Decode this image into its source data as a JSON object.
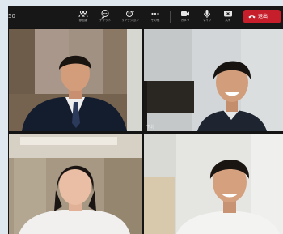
{
  "toolbar": {
    "meeting_time": "50",
    "buttons": [
      {
        "id": "participants",
        "label": "参加者",
        "icon": "people-icon"
      },
      {
        "id": "chat",
        "label": "チャット",
        "icon": "chat-icon"
      },
      {
        "id": "reactions",
        "label": "リアクション",
        "icon": "smile-icon"
      },
      {
        "id": "more",
        "label": "その他",
        "icon": "more-icon"
      },
      {
        "id": "camera",
        "label": "カメラ",
        "icon": "camera-icon"
      },
      {
        "id": "mic",
        "label": "マイク",
        "icon": "mic-icon"
      },
      {
        "id": "share",
        "label": "共有",
        "icon": "share-icon"
      }
    ],
    "leave_label": "退出",
    "leave_color": "#c61f2b"
  },
  "participants": [
    {
      "name": "",
      "position": "top-left"
    },
    {
      "name": "下北",
      "position": "top-right"
    },
    {
      "name": "",
      "position": "bottom-left"
    },
    {
      "name": "",
      "position": "bottom-right"
    }
  ]
}
